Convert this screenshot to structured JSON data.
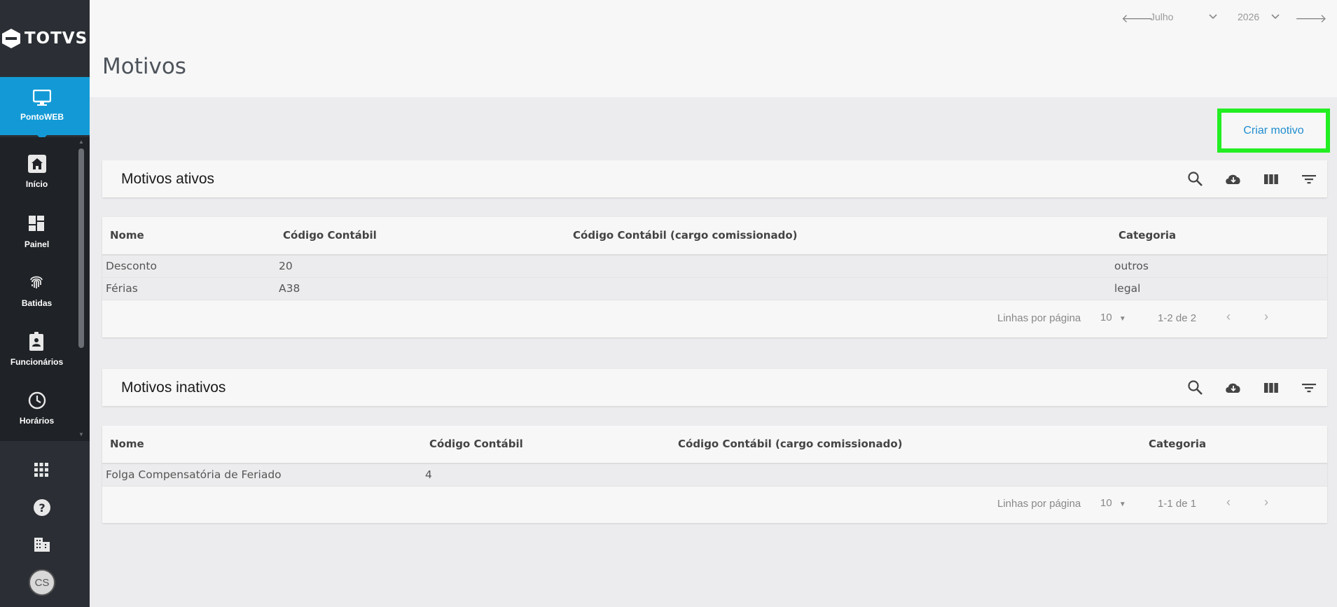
{
  "sidebar": {
    "logo": "TOTVS",
    "app": "PontoWEB",
    "items": [
      {
        "label": "Início",
        "icon": "home-icon"
      },
      {
        "label": "Painel",
        "icon": "dashboard-icon"
      },
      {
        "label": "Batidas",
        "icon": "fingerprint-icon"
      },
      {
        "label": "Funcionários",
        "icon": "badge-icon"
      },
      {
        "label": "Horários",
        "icon": "clock-icon"
      }
    ],
    "bottom": [
      {
        "icon": "apps-grid-icon"
      },
      {
        "icon": "help-icon"
      },
      {
        "icon": "building-icon"
      }
    ],
    "avatar": "CS"
  },
  "header": {
    "title": "Motivos",
    "month": "Julho",
    "year": "2026"
  },
  "actions": {
    "create_label": "Criar motivo"
  },
  "active": {
    "title": "Motivos ativos",
    "columns": [
      "Nome",
      "Código Contábil",
      "Código Contábil (cargo comissionado)",
      "Categoria"
    ],
    "rows": [
      {
        "nome": "Desconto",
        "codigo": "20",
        "codigo_cargo": "",
        "categoria": "outros"
      },
      {
        "nome": "Férias",
        "codigo": "A38",
        "codigo_cargo": "",
        "categoria": "legal"
      }
    ],
    "rows_per_page_label": "Linhas por página",
    "rows_per_page": "10",
    "range": "1-2 de 2"
  },
  "inactive": {
    "title": "Motivos inativos",
    "columns": [
      "Nome",
      "Código Contábil",
      "Código Contábil (cargo comissionado)",
      "Categoria"
    ],
    "rows": [
      {
        "nome": "Folga Compensatória de Feriado",
        "codigo": "4",
        "codigo_cargo": "",
        "categoria": ""
      }
    ],
    "rows_per_page_label": "Linhas por página",
    "rows_per_page": "10",
    "range": "1-1 de 1"
  },
  "colors": {
    "accent": "#139ad6",
    "sidebar": "#2b2f35",
    "highlight": "#22ee22",
    "link": "#1f8dcf"
  }
}
